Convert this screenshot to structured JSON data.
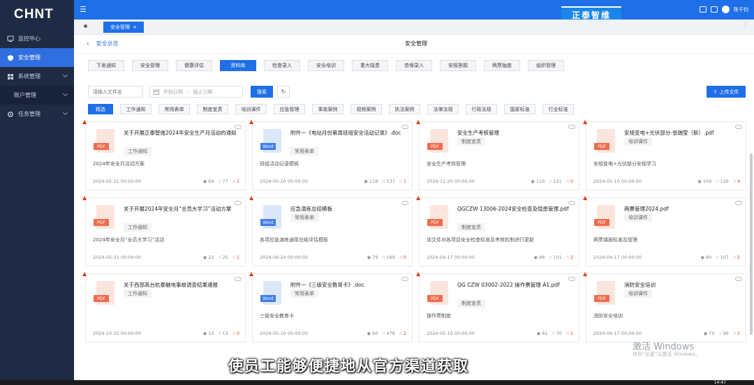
{
  "sidebar": {
    "logo": "CHNT",
    "items": [
      {
        "label": "监控中心"
      },
      {
        "label": "安全管理"
      },
      {
        "label": "系统管理"
      },
      {
        "label": "账户管理"
      },
      {
        "label": "任务管理"
      }
    ]
  },
  "topbar": {
    "brand": "正泰智维",
    "user": "陈千钧"
  },
  "tabbar": {
    "active_tab": "安全管理",
    "close": "×"
  },
  "header": {
    "back_label": "安全总览",
    "title": "安全管理"
  },
  "category_tabs": [
    "下发通知",
    "安全管理",
    "健康评估",
    "资料库",
    "检查录入",
    "安全培训",
    "重大隐患",
    "劳保录入",
    "安规答题",
    "两票抽查",
    "组织管理"
  ],
  "filters": {
    "search_placeholder": "请输入文件名",
    "start_date": "开始日期",
    "separator": "-",
    "end_date": "截止日期",
    "search_button": "搜索",
    "upload_button": "上传文件"
  },
  "sub_tabs": [
    "精选",
    "工作通知",
    "常用表单",
    "制度宣贯",
    "培训课件",
    "应急管理",
    "事故案例",
    "视频案例",
    "执法案例",
    "法律法规",
    "行政法规",
    "国家标准",
    "行业标准"
  ],
  "cards": [
    {
      "title": "关于开展正泰智维2024年安全生产月活动的通知",
      "type": "PDF",
      "tag": "工作通知",
      "desc": "2024年安全月活动方案",
      "date": "2024-05-21 00:00:00",
      "views": "69",
      "likes": "77",
      "hot": "1"
    },
    {
      "title": "附件一《电站月份第周班组安全活动记录》.doc",
      "type": "Word",
      "tag": "常用表单",
      "desc": "班组活动记录模板",
      "date": "2024-05-10 00:00:00",
      "views": "118",
      "likes": "137",
      "hot": "1"
    },
    {
      "title": "安全生产考核管理",
      "type": "PDF",
      "tag": "制度宣贯",
      "desc": "安全生产考核管理",
      "date": "2024-11-20 00:00:00",
      "views": "116",
      "likes": "121",
      "hot": "0"
    },
    {
      "title": "安规变电+光伏部分-张瑞莹（新）.pdf",
      "type": "PDF",
      "tag": "培训课件",
      "desc": "安规变电+光伏部分安规学习",
      "date": "2024-05-10 00:00:00",
      "views": "100",
      "likes": "136",
      "hot": "4"
    },
    {
      "title": "关于开展2024年安全月“全员大学习”活动方案",
      "type": "PDF",
      "tag": "工作通知",
      "desc": "2024年安全月“全员大学习”活动",
      "date": "2024-05-21 00:00:00",
      "views": "22",
      "likes": "25",
      "hot": "1"
    },
    {
      "title": "应急演练总结模板",
      "type": "Word",
      "tag": "常用表单",
      "desc": "各项应急演练通用总结评估模板",
      "date": "2024-06-24 00:00:00",
      "views": "79",
      "likes": "189",
      "hot": "0"
    },
    {
      "title": "QGCZW 13006-2024安全检查及隐患管理.pdf",
      "type": "PDF",
      "tag": "制度宣贯",
      "desc": "该文件对各项目安全检查标准及考核机制进行更新",
      "date": "2024-04-17 00:00:00",
      "views": "98",
      "likes": "101",
      "hot": "2"
    },
    {
      "title": "两票管理2024.pdf",
      "type": "PDF",
      "tag": "培训课件",
      "desc": "两票填报标准及管理",
      "date": "2024-04-17 00:00:00",
      "views": "80",
      "likes": "107",
      "hot": "2"
    },
    {
      "title": "关于西部高台杭泰触电事故调查结果通报",
      "type": "PDF",
      "tag": "工作通知",
      "desc": "",
      "date": "2024-10-25 00:00:00",
      "views": "12",
      "likes": "13",
      "hot": "0"
    },
    {
      "title": "附件一《三级安全教育卡》.doc",
      "type": "Word",
      "tag": "常用表单",
      "desc": "三级安全教育卡",
      "date": "2024-05-10 00:00:00",
      "views": "60",
      "likes": "478",
      "hot": "2"
    },
    {
      "title": "QG CZW 03002-2022 操作票管理 A1.pdf",
      "type": "PDF",
      "tag": "制度宣贯",
      "desc": "操作票制度",
      "date": "2024-05-10 00:00:00",
      "views": "61",
      "likes": "70",
      "hot": "1"
    },
    {
      "title": "消防安全培训",
      "type": "PDF",
      "tag": "培训课件",
      "desc": "消防安全培训",
      "date": "2024-04-17 00:00:00",
      "views": "70",
      "likes": "96",
      "hot": "1"
    }
  ],
  "subtitle": "使员工能够便捷地从官方渠道获取",
  "watermark": {
    "line1": "激活 Windows",
    "line2": "转到“设置”以激活 Windows。"
  },
  "clock": "14:47",
  "colors": {
    "primary": "#1e6fe8",
    "sidebar": "#1f2a44",
    "pdf": "#ef6c4f",
    "word": "#3f7ee8"
  }
}
